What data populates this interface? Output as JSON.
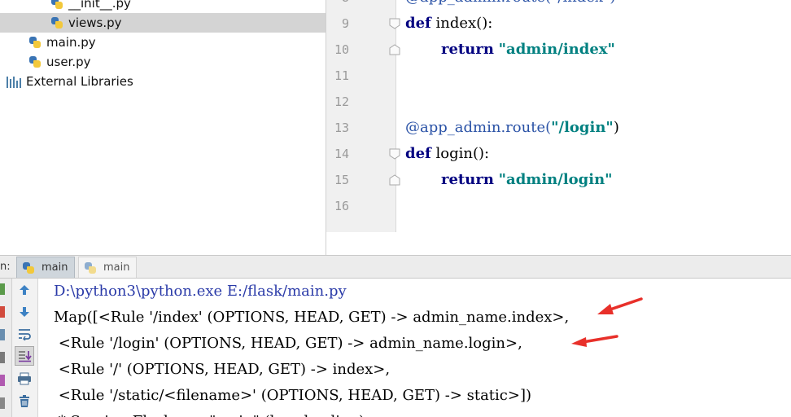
{
  "project_tree": {
    "items": [
      {
        "name": "__init__.py",
        "type": "python-file"
      },
      {
        "name": "views.py",
        "type": "python-file",
        "selected": true
      },
      {
        "name": "main.py",
        "type": "python-file"
      },
      {
        "name": "user.py",
        "type": "python-file"
      },
      {
        "name": "External Libraries",
        "type": "library-icon"
      }
    ]
  },
  "editor": {
    "lines": [
      {
        "num": "8",
        "text": "@app_admin.route(\"/index\")"
      },
      {
        "num": "9",
        "kw": "def",
        "rest": " index():"
      },
      {
        "num": "10",
        "kw": "return",
        "str": "\"admin/index\""
      },
      {
        "num": "11"
      },
      {
        "num": "12"
      },
      {
        "num": "13",
        "dec": "@app_admin.route(",
        "str": "\"/login\"",
        "close": ")"
      },
      {
        "num": "14",
        "kw": "def",
        "rest": " login():"
      },
      {
        "num": "15",
        "kw": "return",
        "str": "\"admin/login\""
      },
      {
        "num": "16"
      }
    ]
  },
  "run_panel": {
    "label": "n:",
    "tabs": [
      {
        "label": "main",
        "active": true
      },
      {
        "label": "main",
        "active": false
      }
    ],
    "toolbar_icons": [
      "up-arrow-icon",
      "down-arrow-icon",
      "soft-wrap-icon",
      "scroll-to-end-icon",
      "print-icon",
      "trash-icon"
    ],
    "console_lines": [
      "D:\\python3\\python.exe E:/flask/main.py",
      "Map([<Rule '/index' (OPTIONS, HEAD, GET) -> admin_name.index>,",
      " <Rule '/login' (OPTIONS, HEAD, GET) -> admin_name.login>,",
      " <Rule '/' (OPTIONS, HEAD, GET) -> index>,",
      " <Rule '/static/<filename>' (OPTIONS, HEAD, GET) -> static>])",
      " * Serving Flask app \"main\" (lazy loading)"
    ],
    "annotation_color": "#e8302a"
  }
}
